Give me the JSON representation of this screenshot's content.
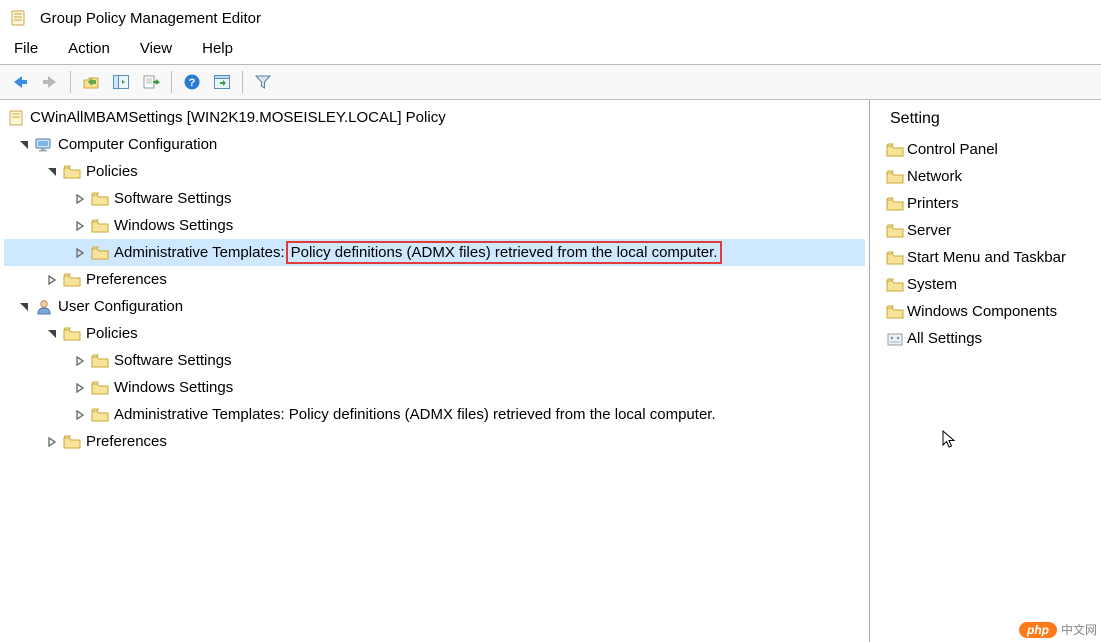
{
  "title": "Group Policy Management Editor",
  "menu": {
    "file": "File",
    "action": "Action",
    "view": "View",
    "help": "Help"
  },
  "tree": {
    "root": "CWinAllMBAMSettings [WIN2K19.MOSEISLEY.LOCAL] Policy",
    "computer": "Computer Configuration",
    "policies": "Policies",
    "software": "Software Settings",
    "windows": "Windows Settings",
    "admin_prefix": "Administrative Templates:",
    "admin_suffix": "Policy definitions (ADMX files) retrieved from the local computer.",
    "admin_full": "Administrative Templates: Policy definitions (ADMX files) retrieved from the local computer.",
    "preferences": "Preferences",
    "user": "User Configuration"
  },
  "right": {
    "header": "Setting",
    "items": [
      "Control Panel",
      "Network",
      "Printers",
      "Server",
      "Start Menu and Taskbar",
      "System",
      "Windows Components",
      "All Settings"
    ]
  },
  "watermark": {
    "badge": "php",
    "text": "中文网"
  }
}
